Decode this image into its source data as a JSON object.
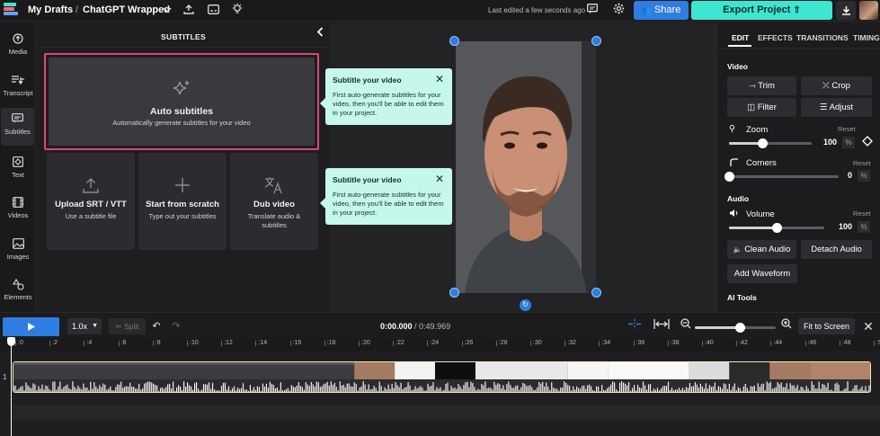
{
  "topbar": {
    "breadcrumb_root": "My Drafts",
    "project_name": "ChatGPT Wrapped",
    "last_edited": "Last edited a few seconds ago",
    "share_label": "Share",
    "export_label": "Export Project",
    "icons": [
      "chevron-down-icon",
      "upload-icon",
      "subtitles-icon",
      "lightbulb-icon",
      "comment-icon",
      "gear-icon",
      "download-icon"
    ]
  },
  "rail": {
    "items": [
      {
        "label": "Media",
        "icon": "media-icon"
      },
      {
        "label": "Transcript",
        "icon": "transcript-icon"
      },
      {
        "label": "Subtitles",
        "icon": "subtitles-icon"
      },
      {
        "label": "Text",
        "icon": "text-icon"
      },
      {
        "label": "Videos",
        "icon": "videos-icon"
      },
      {
        "label": "Images",
        "icon": "images-icon"
      },
      {
        "label": "Elements",
        "icon": "elements-icon"
      }
    ],
    "active": "Subtitles"
  },
  "subtitles_panel": {
    "title": "SUBTITLES",
    "auto": {
      "title": "Auto subtitles",
      "description": "Automatically generate subtitles for your video"
    },
    "options": [
      {
        "title": "Upload SRT / VTT",
        "description": "Use a subtitle file",
        "icon": "upload-icon"
      },
      {
        "title": "Start from scratch",
        "description": "Type out your subtitles",
        "icon": "plus-icon"
      },
      {
        "title": "Dub video",
        "description": "Translate audio & subtitles",
        "icon": "translate-icon"
      }
    ]
  },
  "tooltips": [
    {
      "title": "Subtitle your video",
      "text": "First auto-generate subtitles for your video, then you'll be able to edit them in your project."
    },
    {
      "title": "Subtitle your video",
      "text": "First auto-generate subtitles for your video, then you'll be able to edit them in your project."
    }
  ],
  "right_panel": {
    "tabs": [
      "EDIT",
      "EFFECTS",
      "TRANSITIONS",
      "TIMING"
    ],
    "active_tab": "EDIT",
    "video_section": "Video",
    "buttons": {
      "trim": "Trim",
      "crop": "Crop",
      "filter": "Filter",
      "adjust": "Adjust"
    },
    "zoom": {
      "label": "Zoom",
      "reset": "Reset",
      "value": "100",
      "unit": "%",
      "level": 0.4
    },
    "corners": {
      "label": "Corners",
      "reset": "Reset",
      "value": "0",
      "unit": "%",
      "level": 0.0
    },
    "audio_section": "Audio",
    "volume": {
      "label": "Volume",
      "reset": "Reset",
      "value": "100",
      "unit": "%",
      "level": 0.5
    },
    "clean_audio": "Clean Audio",
    "detach_audio": "Detach Audio",
    "add_waveform": "Add Waveform",
    "ai_tools": "AI Tools"
  },
  "timeline": {
    "speed": "1.0x",
    "split": "Split",
    "current_time": "0:00.000",
    "duration": "/ 0:49.969",
    "fit_label": "Fit to Screen",
    "zoom_level": 0.55,
    "ticks": [
      ":0",
      ":2",
      ":4",
      ":6",
      ":8",
      ":10",
      ":12",
      ":14",
      ":16",
      ":18",
      ":20",
      ":22",
      ":24",
      ":26",
      ":28",
      ":30",
      ":32",
      ":34",
      ":36",
      ":38",
      ":40",
      ":42",
      ":44",
      ":46",
      ":48",
      ":5"
    ],
    "track_number": "1"
  },
  "colors": {
    "accent_blue": "#2f7de1",
    "export_teal": "#3ee6d2",
    "tooltip_bg": "#c6f7ec",
    "highlight_pink": "#d9487a",
    "clip_border": "#f2e6a8"
  }
}
